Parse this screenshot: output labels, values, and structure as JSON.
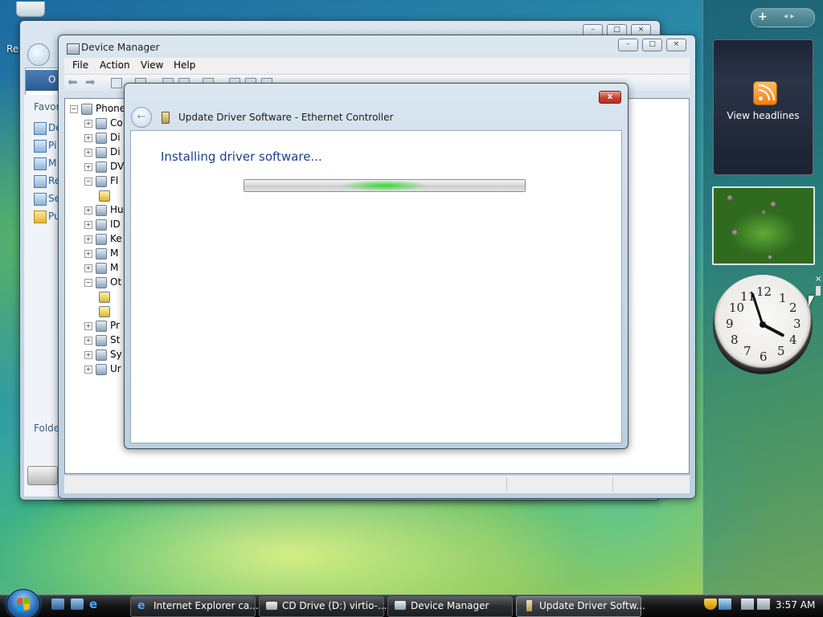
{
  "desktop": {
    "recycle_label": "Re"
  },
  "back_window": {
    "nav_label": "O",
    "favorites_label": "Favor",
    "folders_label": "Folde",
    "left_items": [
      "De",
      "Pi",
      "M",
      "Re",
      "Se",
      "Pu"
    ]
  },
  "device_manager": {
    "title": "Device Manager",
    "menu": [
      "File",
      "Action",
      "View",
      "Help"
    ],
    "tree": [
      {
        "label": "Phone",
        "exp": "minus"
      },
      {
        "label": "Co",
        "exp": "plus"
      },
      {
        "label": "Di",
        "exp": "plus"
      },
      {
        "label": "Di",
        "exp": "plus"
      },
      {
        "label": "DV",
        "exp": "plus"
      },
      {
        "label": "Fl",
        "exp": "minus"
      },
      {
        "label": "",
        "exp": ""
      },
      {
        "label": "Hu",
        "exp": "plus"
      },
      {
        "label": "ID",
        "exp": "plus"
      },
      {
        "label": "Ke",
        "exp": "plus"
      },
      {
        "label": "M",
        "exp": "plus"
      },
      {
        "label": "M",
        "exp": "plus"
      },
      {
        "label": "Ot",
        "exp": "minus"
      },
      {
        "label": "",
        "exp": ""
      },
      {
        "label": "",
        "exp": ""
      },
      {
        "label": "Pr",
        "exp": "plus"
      },
      {
        "label": "St",
        "exp": "plus"
      },
      {
        "label": "Sy",
        "exp": "plus"
      },
      {
        "label": "Ur",
        "exp": "plus"
      }
    ]
  },
  "update_driver": {
    "title": "Update Driver Software - Ethernet Controller",
    "heading": "Installing driver software...",
    "close_label": "x",
    "back_label": "←"
  },
  "gadgets": {
    "plus_label": "+",
    "arrows_label": "◂ ▸",
    "feed_label": "View headlines",
    "clock_numbers": [
      "12",
      "1",
      "2",
      "3",
      "4",
      "5",
      "6",
      "7",
      "8",
      "9",
      "10",
      "11"
    ],
    "clock_close": "×"
  },
  "taskbar": {
    "buttons": [
      {
        "label": "Internet Explorer ca..."
      },
      {
        "label": "CD Drive (D:) virtio-..."
      },
      {
        "label": "Device Manager"
      },
      {
        "label": "Update Driver Softw..."
      }
    ],
    "time": "3:57 AM"
  },
  "colors": {
    "accent_blue": "#1c3f94",
    "progress_green": "#28dc28",
    "close_red": "#c7402b"
  }
}
